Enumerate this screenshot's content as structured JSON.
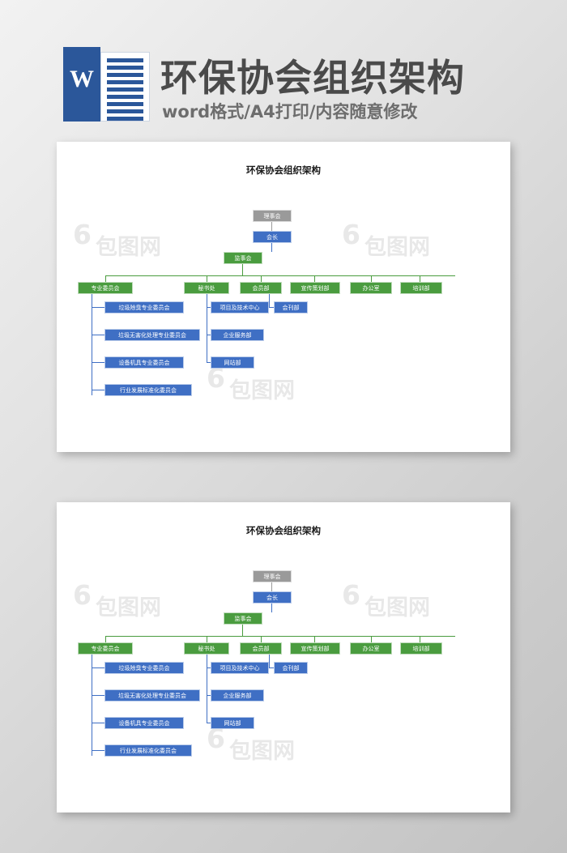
{
  "header": {
    "logo_letter": "W",
    "title": "环保协会组织架构",
    "subtitle": "word格式/A4打印/内容随意修改"
  },
  "watermarks": [
    "6",
    "包图网",
    "6",
    "包图网",
    "6",
    "包图网"
  ],
  "pages": [
    {
      "title": "环保协会组织架构"
    },
    {
      "title": "环保协会组织架构"
    }
  ],
  "chart_data": {
    "type": "diagram",
    "title": "环保协会组织架构",
    "colors": {
      "council": "#9a9a9a",
      "blue": "#3f6fc4",
      "green": "#4a9c3f"
    },
    "nodes": {
      "council": "理事会",
      "president": "会长",
      "supervisor": "监事会",
      "level3": [
        "专业委员会",
        "秘书处",
        "会员部",
        "宣传策划部",
        "办公室",
        "培训部"
      ],
      "committee_children": [
        "垃圾除臭专业委员会",
        "垃圾无害化处理专业委员会",
        "设备机具专业委员会",
        "行业发展标准化委员会"
      ],
      "secretariat_children": [
        "项目及技术中心",
        "企业服务部",
        "网站部"
      ],
      "member_children": [
        "会刊部"
      ]
    }
  }
}
